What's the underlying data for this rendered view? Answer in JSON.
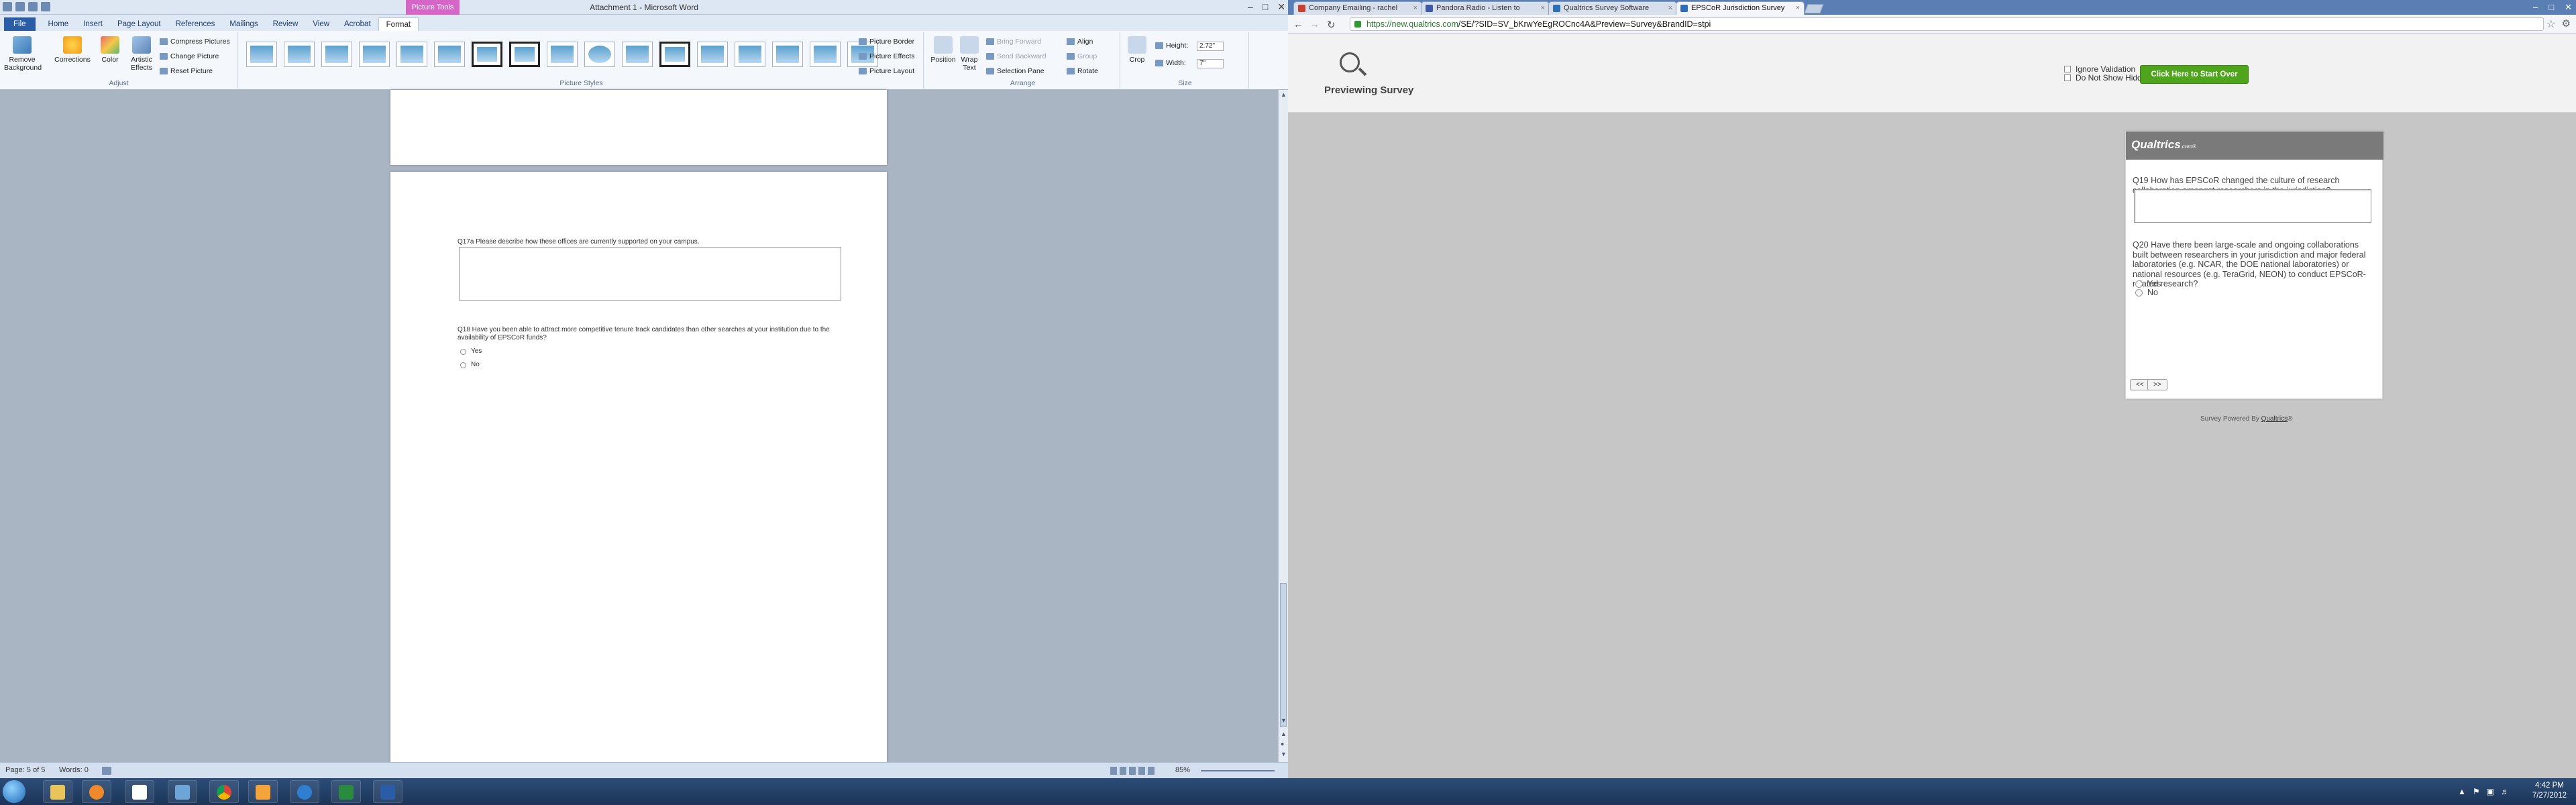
{
  "word": {
    "title": "Attachment 1 - Microsoft Word",
    "picture_tools_label": "Picture Tools",
    "tabs": [
      "File",
      "Home",
      "Insert",
      "Page Layout",
      "References",
      "Mailings",
      "Review",
      "View",
      "Acrobat",
      "Format"
    ],
    "active_tab": "Format",
    "ribbon": {
      "remove_background": "Remove Background",
      "corrections": "Corrections",
      "color": "Color",
      "artistic_effects": "Artistic Effects",
      "compress_pictures": "Compress Pictures",
      "change_picture": "Change Picture",
      "reset_picture": "Reset Picture",
      "adjust_group": "Adjust",
      "picture_border": "Picture Border",
      "picture_effects": "Picture Effects",
      "picture_layout": "Picture Layout",
      "picture_styles_group": "Picture Styles",
      "position": "Position",
      "wrap_text": "Wrap Text",
      "bring_forward": "Bring Forward",
      "send_backward": "Send Backward",
      "selection_pane": "Selection Pane",
      "align": "Align",
      "group": "Group",
      "rotate": "Rotate",
      "arrange_group": "Arrange",
      "crop": "Crop",
      "height_label": "Height:",
      "height_value": "2.72\"",
      "width_label": "Width:",
      "width_value": "7\"",
      "size_group": "Size"
    },
    "document": {
      "q17a": "Q17a  Please describe how these offices are currently supported on your campus.",
      "q18": "Q18  Have you been able to attract more competitive tenure track candidates than other searches at your institution due to the availability of EPSCoR funds?",
      "yes": "Yes",
      "no": "No"
    },
    "status": {
      "page": "Page: 5 of 5",
      "words": "Words: 0",
      "zoom": "85%"
    }
  },
  "browser": {
    "tabs": [
      {
        "label": "Company Emailing - rachel",
        "color": "#c9402f"
      },
      {
        "label": "Pandora Radio - Listen to",
        "color": "#3c5aa8"
      },
      {
        "label": "Qualtrics Survey Software",
        "color": "#2d6fb7"
      },
      {
        "label": "EPSCoR Jurisdiction Survey",
        "color": "#2d6fb7"
      }
    ],
    "url_host": "https://new.qualtrics.com",
    "url_path": "/SE/?SID=SV_bKrwYeEgROCnc4A&Preview=Survey&BrandID=stpi",
    "preview_title": "Previewing Survey",
    "ignore_validation": "Ignore Validation",
    "hidden_questions": "Do Not Show Hidden Questions",
    "start_over": "Click Here to Start Over",
    "logo": "Qualtrics",
    "logo_suffix": ".com®",
    "q19": "Q19  How has EPSCoR changed the culture of research collaboration amongst researchers in the jurisdiction?",
    "q20": "Q20  Have there been large-scale and ongoing collaborations built between researchers in your jurisdiction and major federal laboratories (e.g. NCAR, the DOE national laboratories) or national resources (e.g. TeraGrid, NEON) to conduct EPSCoR-related research?",
    "yes": "Yes",
    "no": "No",
    "back_btn": "<<",
    "next_btn": ">>",
    "powered_prefix": "Survey Powered By",
    "powered_link": "Qualtrics",
    "powered_suffix": "®"
  },
  "taskbar": {
    "items": [
      "explorer",
      "media-player",
      "ida",
      "network",
      "chrome",
      "outlook",
      "ie",
      "excel",
      "word"
    ],
    "time": "4:42 PM",
    "date": "7/27/2012"
  },
  "colors": {
    "word_picture_tools": "#d665c8",
    "qualtrics_green": "#4ea51c",
    "taskbar": "#1c3457"
  }
}
